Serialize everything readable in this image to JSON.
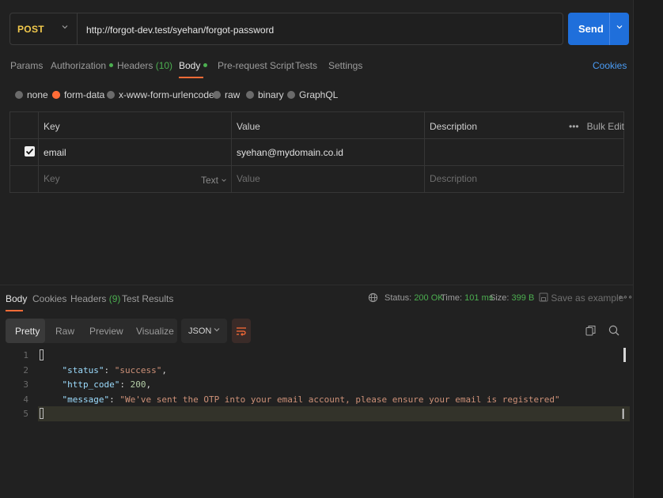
{
  "request": {
    "method": "POST",
    "url": "http://forgot-dev.test/syehan/forgot-password",
    "send_label": "Send"
  },
  "request_tabs": {
    "params": "Params",
    "authorization": "Authorization",
    "headers": "Headers",
    "headers_count": "(10)",
    "body": "Body",
    "pre_request": "Pre-request Script",
    "tests": "Tests",
    "settings": "Settings",
    "cookies": "Cookies"
  },
  "body_types": {
    "none": "none",
    "form_data": "form-data",
    "urlencoded": "x-www-form-urlencoded",
    "raw": "raw",
    "binary": "binary",
    "graphql": "GraphQL",
    "selected": "form-data"
  },
  "params_table": {
    "headers": {
      "key": "Key",
      "value": "Value",
      "description": "Description",
      "bulk_edit": "Bulk Edit"
    },
    "rows": [
      {
        "checked": true,
        "key": "email",
        "value": "syehan@mydomain.co.id",
        "description": ""
      }
    ],
    "placeholder": {
      "key": "Key",
      "type": "Text",
      "value": "Value",
      "description": "Description"
    }
  },
  "response_tabs": {
    "body": "Body",
    "cookies": "Cookies",
    "headers": "Headers",
    "headers_count": "(9)",
    "test_results": "Test Results"
  },
  "response_status": {
    "status_label": "Status:",
    "status_value": "200 OK",
    "time_label": "Time:",
    "time_value": "101 ms",
    "size_label": "Size:",
    "size_value": "399 B",
    "save_example": "Save as example"
  },
  "format_toolbar": {
    "pretty": "Pretty",
    "raw": "Raw",
    "preview": "Preview",
    "visualize": "Visualize",
    "language": "JSON"
  },
  "response_body": {
    "line_numbers": [
      "1",
      "2",
      "3",
      "4",
      "5"
    ],
    "status_key": "\"status\"",
    "status_value": "\"success\"",
    "http_code_key": "\"http_code\"",
    "http_code_value": "200",
    "message_key": "\"message\"",
    "message_value": "\"We've sent the OTP into your email account, please ensure your email is registered\""
  },
  "colors": {
    "accent": "#ff6c37",
    "send": "#1f6fdb",
    "method": "#f2c94c",
    "success": "#4caf50",
    "link": "#4a9cf5"
  }
}
